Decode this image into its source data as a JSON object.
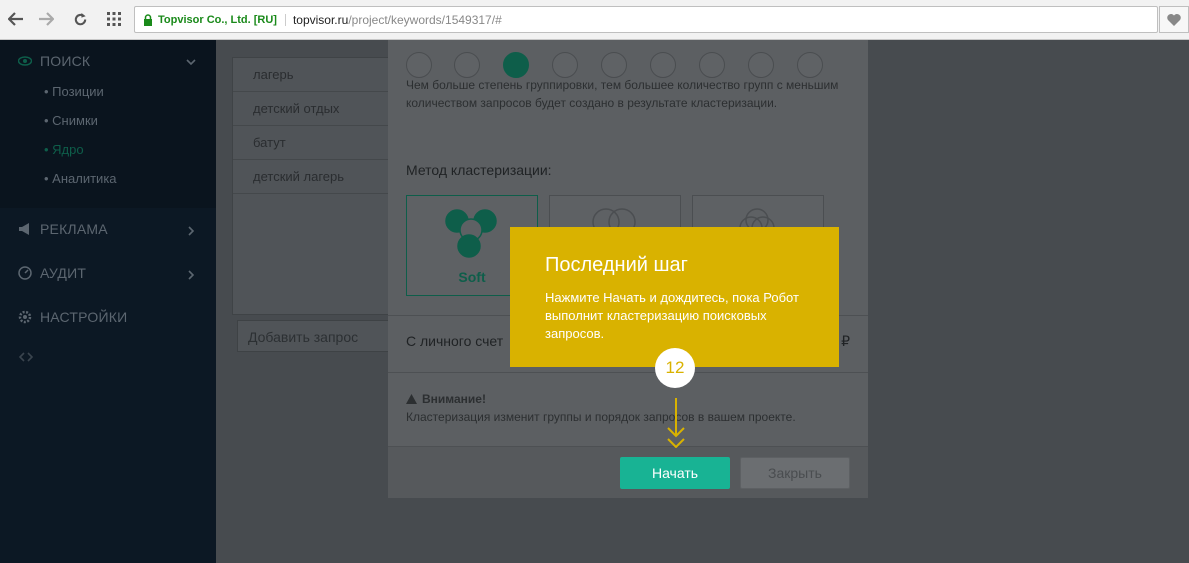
{
  "browser": {
    "cert_label": "Topvisor Co., Ltd. [RU]",
    "url_host": "topvisor.ru",
    "url_path": "/project/keywords/1549317/#"
  },
  "sidebar": {
    "sections": [
      {
        "label": "ПОИСК",
        "icon": "eye-icon"
      },
      {
        "label": "РЕКЛАМА",
        "icon": "megaphone-icon"
      },
      {
        "label": "АУДИТ",
        "icon": "dashboard-icon"
      },
      {
        "label": "НАСТРОЙКИ",
        "icon": "gear-icon"
      }
    ],
    "sub_items": [
      {
        "label": "Позиции"
      },
      {
        "label": "Снимки"
      },
      {
        "label": "Ядро"
      },
      {
        "label": "Аналитика"
      }
    ]
  },
  "keywords": {
    "rows": [
      "лагерь",
      "детский отдых",
      "батут",
      "детский лагерь"
    ],
    "add_placeholder": "Добавить запрос"
  },
  "modal": {
    "description": "Чем больше степень группировки, тем большее количество групп с меньшим количеством запросов будет создано в результате кластеризации.",
    "method_heading": "Метод кластеризации:",
    "methods": [
      {
        "label": "Soft"
      },
      {
        "label": ""
      },
      {
        "label": ""
      }
    ],
    "account_label": "С личного счет",
    "currency": "₽",
    "warning_title": "Внимание!",
    "warning_text": "Кластеризация изменит группы и порядок запросов в вашем проекте.",
    "start_button": "Начать",
    "close_button": "Закрыть"
  },
  "tooltip": {
    "title": "Последний шаг",
    "body": "Нажмите Начать и дождитесь, пока Робот выполнит кластеризацию поисковых запросов.",
    "step_number": "12"
  },
  "colors": {
    "accent": "#18b394",
    "tooltip": "#d9b200",
    "sidebar": "#0c1824"
  }
}
